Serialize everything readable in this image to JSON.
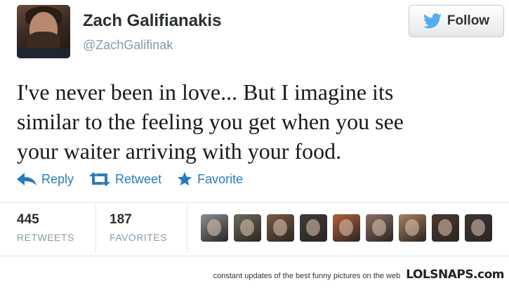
{
  "profile": {
    "name": "Zach Galifianakis",
    "handle": "@ZachGalifinak",
    "avatar_icon": "user-photo"
  },
  "follow_button": {
    "label": "Follow",
    "icon": "twitter-bird-icon",
    "icon_color": "#55acee"
  },
  "tweet": {
    "text": "I've never been in love... But I imagine its\nsimilar to the feeling you get when you see\nyour waiter arriving with your food."
  },
  "actions": [
    {
      "label": "Reply",
      "icon": "reply-icon"
    },
    {
      "label": "Retweet",
      "icon": "retweet-icon"
    },
    {
      "label": "Favorite",
      "icon": "star-icon"
    }
  ],
  "stats": {
    "retweets": {
      "value": "445",
      "caption": "RETWEETS"
    },
    "favorites": {
      "value": "187",
      "caption": "FAVORITES"
    }
  },
  "favorited_by_colors": [
    "#8a8f94",
    "#6e6a5c",
    "#7a5a44",
    "#3d3a38",
    "#b0603a",
    "#8c6f66",
    "#a88060",
    "#4a3830",
    "#3a3636"
  ],
  "footer": {
    "tagline": "constant updates of the best funny pictures on the web",
    "brand": "LOLSNAPS.com"
  },
  "colors": {
    "link": "#2b7bb9",
    "muted": "#8899a6"
  }
}
